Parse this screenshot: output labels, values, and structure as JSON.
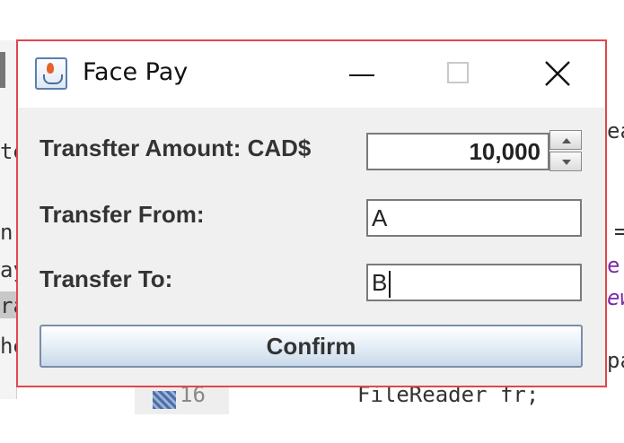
{
  "window": {
    "title": "Face Pay",
    "border_color": "#e0474c",
    "icon": "java-cup-icon"
  },
  "form": {
    "amount_label": "Transfter Amount: CAD$",
    "amount_value": "10,000",
    "from_label": "Transfer From:",
    "from_value": "A",
    "to_label": "Transfer To:",
    "to_value": "B"
  },
  "confirm_label": "Confirm",
  "background": {
    "frag_te": "te",
    "frag_n": "n",
    "frag_ay": "ay",
    "frag_ra": "ra",
    "frag_he": "he",
    "frag_ea": "ea",
    "frag_eq": "=",
    "frag_e_bracket": "e[",
    "frag_ew": "ew",
    "frag_pa": "pa",
    "line_number": "16",
    "code_line": "FileReader fr;"
  }
}
